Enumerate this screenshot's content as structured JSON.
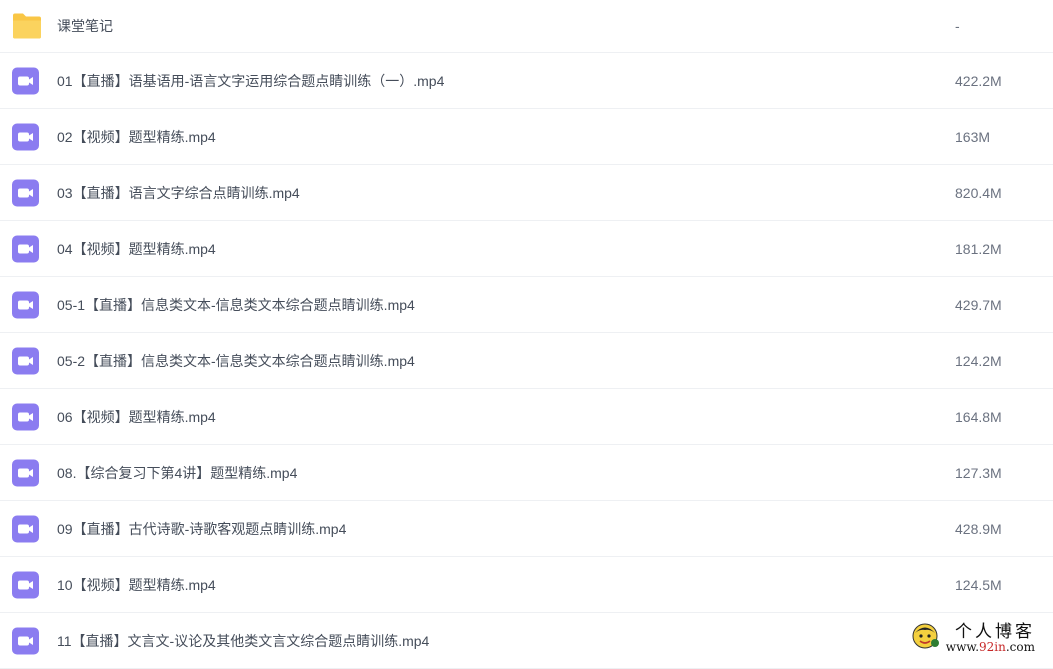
{
  "files": [
    {
      "icon": "folder-icon",
      "name": "课堂笔记",
      "size": "-"
    },
    {
      "icon": "video-icon",
      "name": "01【直播】语基语用-语言文字运用综合题点睛训练（一）.mp4",
      "size": "422.2M"
    },
    {
      "icon": "video-icon",
      "name": "02【视频】题型精练.mp4",
      "size": "163M"
    },
    {
      "icon": "video-icon",
      "name": "03【直播】语言文字综合点睛训练.mp4",
      "size": "820.4M"
    },
    {
      "icon": "video-icon",
      "name": "04【视频】题型精练.mp4",
      "size": "181.2M"
    },
    {
      "icon": "video-icon",
      "name": "05-1【直播】信息类文本-信息类文本综合题点睛训练.mp4",
      "size": "429.7M"
    },
    {
      "icon": "video-icon",
      "name": "05-2【直播】信息类文本-信息类文本综合题点睛训练.mp4",
      "size": "124.2M"
    },
    {
      "icon": "video-icon",
      "name": "06【视频】题型精练.mp4",
      "size": "164.8M"
    },
    {
      "icon": "video-icon",
      "name": "08.【综合复习下第4讲】题型精练.mp4",
      "size": "127.3M"
    },
    {
      "icon": "video-icon",
      "name": "09【直播】古代诗歌-诗歌客观题点睛训练.mp4",
      "size": "428.9M"
    },
    {
      "icon": "video-icon",
      "name": "10【视频】题型精练.mp4",
      "size": "124.5M"
    },
    {
      "icon": "video-icon",
      "name": "11【直播】文言文-议论及其他类文言文综合题点睛训练.mp4",
      "size": ""
    }
  ],
  "watermark": {
    "title": "个人博客",
    "url_prefix": "www.",
    "url_highlight": "92in",
    "url_suffix": ".com"
  },
  "colors": {
    "folder": "#f9c645",
    "video": "#8b7cf0",
    "name_text": "#454d5a",
    "size_text": "#6b7280",
    "divider": "#eef0f3"
  }
}
